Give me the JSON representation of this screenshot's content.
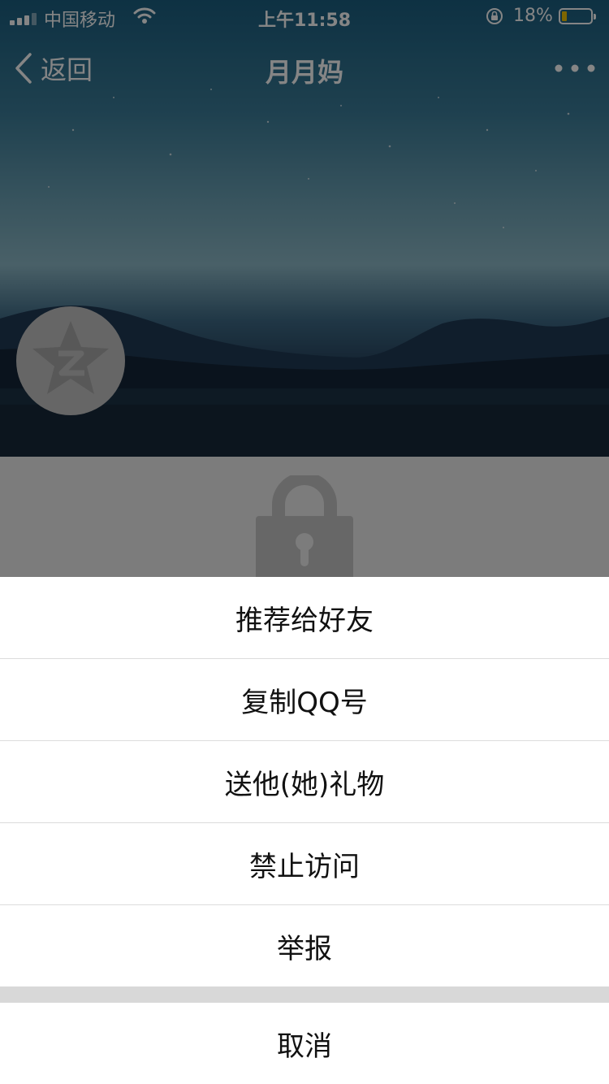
{
  "status_bar": {
    "carrier": "中国移动",
    "time": "上午11:58",
    "battery": "18%",
    "battery_level": 0.18
  },
  "nav": {
    "back_label": "返回",
    "title": "月月妈"
  },
  "sheet": {
    "items": [
      {
        "label": "推荐给好友"
      },
      {
        "label": "复制QQ号"
      },
      {
        "label": "送他(她)礼物"
      },
      {
        "label": "禁止访问"
      },
      {
        "label": "举报"
      }
    ],
    "cancel_label": "取消"
  },
  "icons": [
    "signal-icon",
    "wifi-icon",
    "rotation-lock-icon",
    "battery-icon",
    "back-chevron-icon",
    "more-icon",
    "qzone-star-icon",
    "lock-icon"
  ],
  "colors": {
    "sheet_background": "#ffffff",
    "sheet_gap": "#d8d8d8",
    "battery_fill": "#f2c300"
  }
}
